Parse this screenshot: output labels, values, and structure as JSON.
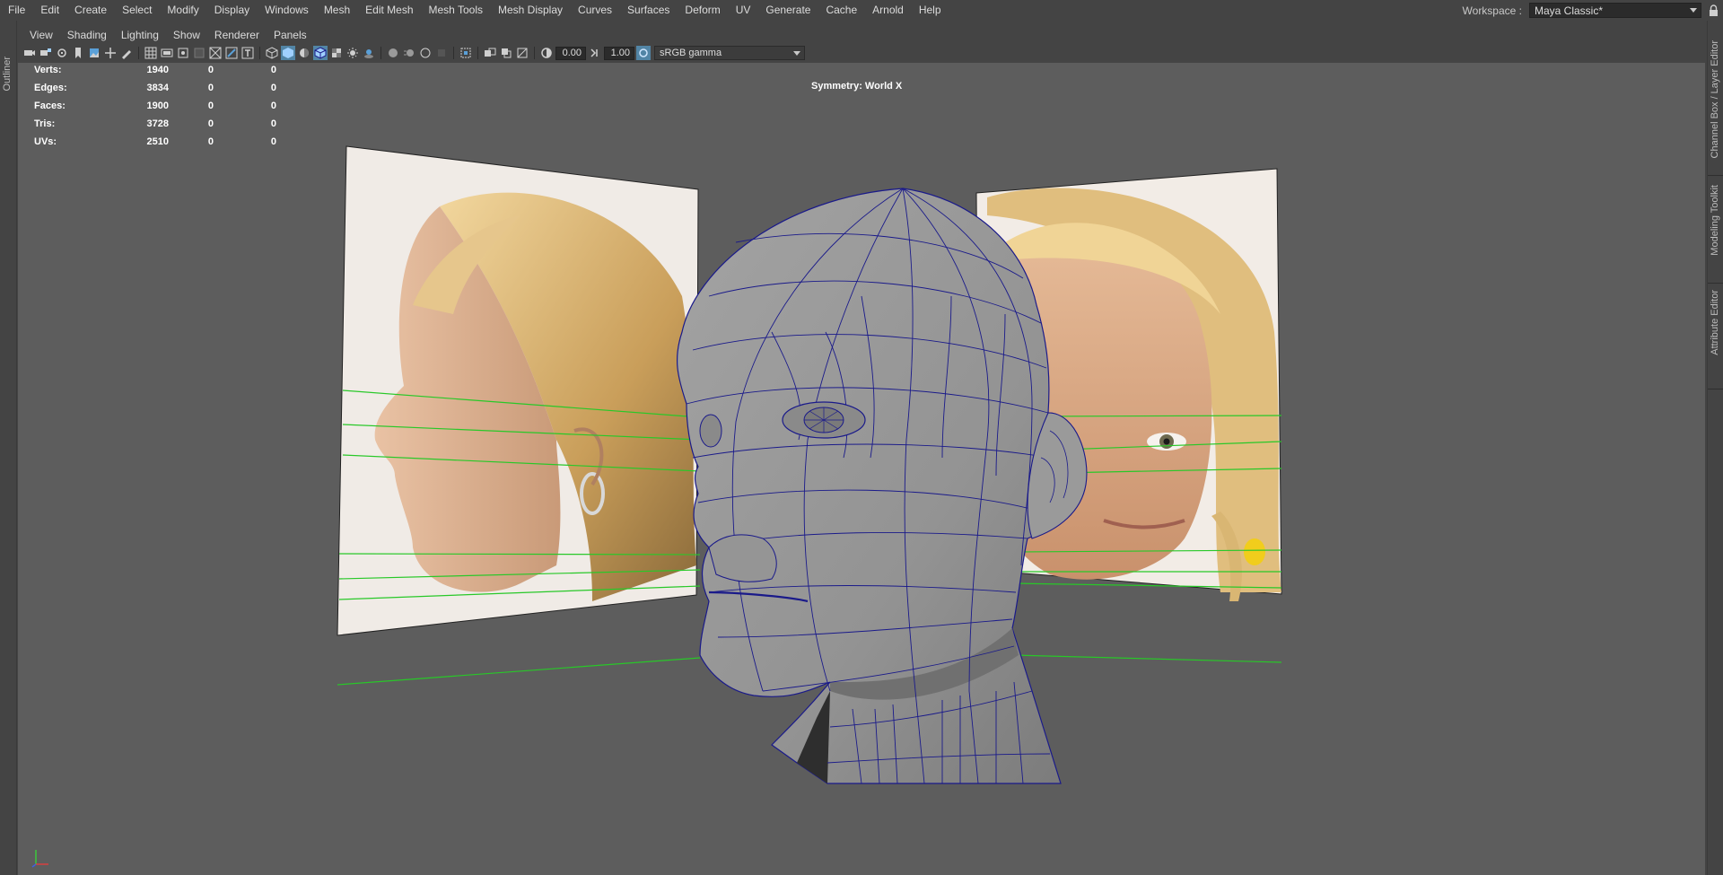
{
  "menubar": {
    "items": [
      "File",
      "Edit",
      "Create",
      "Select",
      "Modify",
      "Display",
      "Windows",
      "Mesh",
      "Edit Mesh",
      "Mesh Tools",
      "Mesh Display",
      "Curves",
      "Surfaces",
      "Deform",
      "UV",
      "Generate",
      "Cache",
      "Arnold",
      "Help"
    ]
  },
  "workspace": {
    "label": "Workspace :",
    "value": "Maya Classic*"
  },
  "left_tabs": {
    "outliner": "Outliner"
  },
  "right_tabs": {
    "channel_box": "Channel Box / Layer Editor",
    "modeling_toolkit": "Modeling Toolkit",
    "attribute_editor": "Attribute Editor"
  },
  "panel_menu": {
    "items": [
      "View",
      "Shading",
      "Lighting",
      "Show",
      "Renderer",
      "Panels"
    ]
  },
  "toolbar": {
    "exposure": "0.00",
    "gamma": "1.00",
    "colorspace": "sRGB gamma"
  },
  "hud": {
    "rows": [
      {
        "label": "Verts:",
        "v1": "1940",
        "v2": "0",
        "v3": "0"
      },
      {
        "label": "Edges:",
        "v1": "3834",
        "v2": "0",
        "v3": "0"
      },
      {
        "label": "Faces:",
        "v1": "1900",
        "v2": "0",
        "v3": "0"
      },
      {
        "label": "Tris:",
        "v1": "3728",
        "v2": "0",
        "v3": "0"
      },
      {
        "label": "UVs:",
        "v1": "2510",
        "v2": "0",
        "v3": "0"
      }
    ],
    "symmetry": "Symmetry: World X"
  },
  "colors": {
    "ui_bg": "#444444",
    "viewport_bg": "#5d5d5d",
    "wire": "#1a1a8a",
    "guide_line": "#28c828",
    "mesh": "#9a9a9a"
  }
}
